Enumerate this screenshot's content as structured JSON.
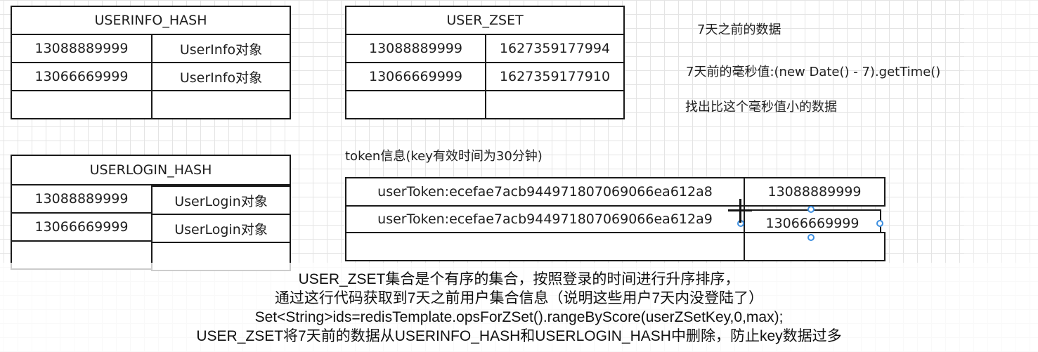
{
  "userinfo_hash": {
    "title": "USERINFO_HASH",
    "rows": [
      [
        "13088889999",
        "UserInfo对象"
      ],
      [
        "13066669999",
        "UserInfo对象"
      ],
      [
        "",
        ""
      ]
    ]
  },
  "user_zset": {
    "title": "USER_ZSET",
    "rows": [
      [
        "13088889999",
        "1627359177994"
      ],
      [
        "13066669999",
        "1627359177910"
      ],
      [
        "",
        ""
      ]
    ]
  },
  "userlogin_hash": {
    "title": "USERLOGIN_HASH",
    "rows": [
      [
        "13088889999",
        "UserLogin对象"
      ],
      [
        "13066669999",
        "UserLogin对象"
      ],
      [
        "",
        ""
      ]
    ]
  },
  "token_table": {
    "label": "token信息(key有效时间为30分钟)",
    "rows": [
      [
        "userToken:ecefae7acb944971807069066ea612a8",
        "13088889999"
      ],
      [
        "userToken:ecefae7acb944971807069066ea612a9",
        "13066669999"
      ],
      [
        "",
        ""
      ]
    ]
  },
  "notes": {
    "seven_days": "7天之前的数据",
    "millis": "7天前的毫秒值:(new Date() - 7).getTime()",
    "find_smaller": "找出比这个毫秒值小的数据"
  },
  "caption": {
    "line1": "USER_ZSET集合是个有序的集合，按照登录的时间进行升序排序，",
    "line2": "通过这行代码获取到7天之前用户集合信息（说明这些用户7天内没登陆了）",
    "line3": "Set<String>ids=redisTemplate.opsForZSet().rangeByScore(userZSetKey,0,max);",
    "line4": "USER_ZSET将7天前的数据从USERINFO_HASH和USERLOGIN_HASH中删除，防止key数据过多"
  },
  "colors": {
    "grid": "#e4e4e4",
    "border": "#1a1a1a",
    "selection": "#3d8fe0"
  }
}
